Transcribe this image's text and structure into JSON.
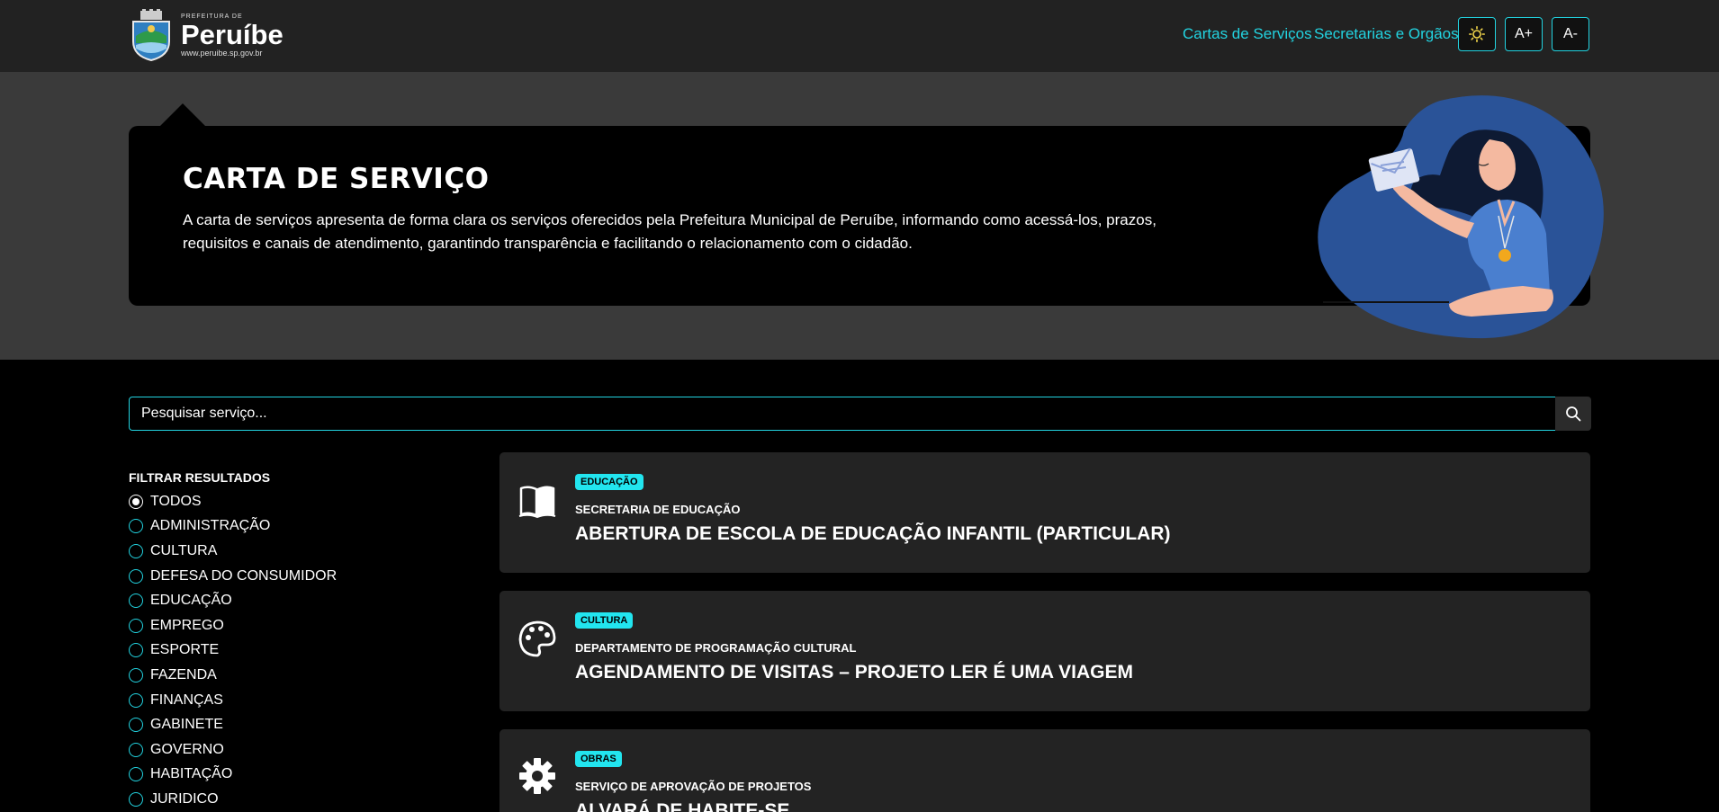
{
  "header": {
    "logo": {
      "pre": "PREFEITURA DE",
      "name": "Peruíbe",
      "url": "www.peruibe.sp.gov.br"
    },
    "nav": [
      {
        "label": "Cartas de Serviços"
      },
      {
        "label": "Secretarias e Orgãos"
      }
    ],
    "buttons": {
      "theme_icon": "sun-icon",
      "font_increase": "A+",
      "font_decrease": "A-"
    }
  },
  "hero": {
    "title": "CARTA DE SERVIÇO",
    "description": "A carta de serviços apresenta de forma clara os serviços oferecidos pela Prefeitura Municipal de Peruíbe, informando como acessá-los, prazos, requisitos e canais de atendimento, garantindo transparência e facilitando o relacionamento com o cidadão."
  },
  "search": {
    "placeholder": "Pesquisar serviço..."
  },
  "filter": {
    "title": "FILTRAR RESULTADOS",
    "selected": "TODOS",
    "options": [
      "TODOS",
      "ADMINISTRAÇÃO",
      "CULTURA",
      "DEFESA DO CONSUMIDOR",
      "EDUCAÇÃO",
      "EMPREGO",
      "ESPORTE",
      "FAZENDA",
      "FINANÇAS",
      "GABINETE",
      "GOVERNO",
      "HABITAÇÃO",
      "JURIDICO"
    ]
  },
  "services": [
    {
      "badge": "EDUCAÇÃO",
      "department": "SECRETARIA DE EDUCAÇÃO",
      "title": "ABERTURA DE ESCOLA DE EDUCAÇÃO INFANTIL (PARTICULAR)",
      "icon": "book-icon"
    },
    {
      "badge": "CULTURA",
      "department": "DEPARTAMENTO DE PROGRAMAÇÃO CULTURAL",
      "title": "AGENDAMENTO DE VISITAS – PROJETO LER É UMA VIAGEM",
      "icon": "palette-icon"
    },
    {
      "badge": "OBRAS",
      "department": "SERVIÇO DE APROVAÇÃO DE PROJETOS",
      "title": "ALVARÁ DE HABITE-SE",
      "icon": "gear-icon"
    }
  ],
  "colors": {
    "accent": "#22d3e0",
    "badge": "#22e5ef",
    "card": "#232323",
    "header": "#222222",
    "hero_band": "#3a3a3a"
  }
}
